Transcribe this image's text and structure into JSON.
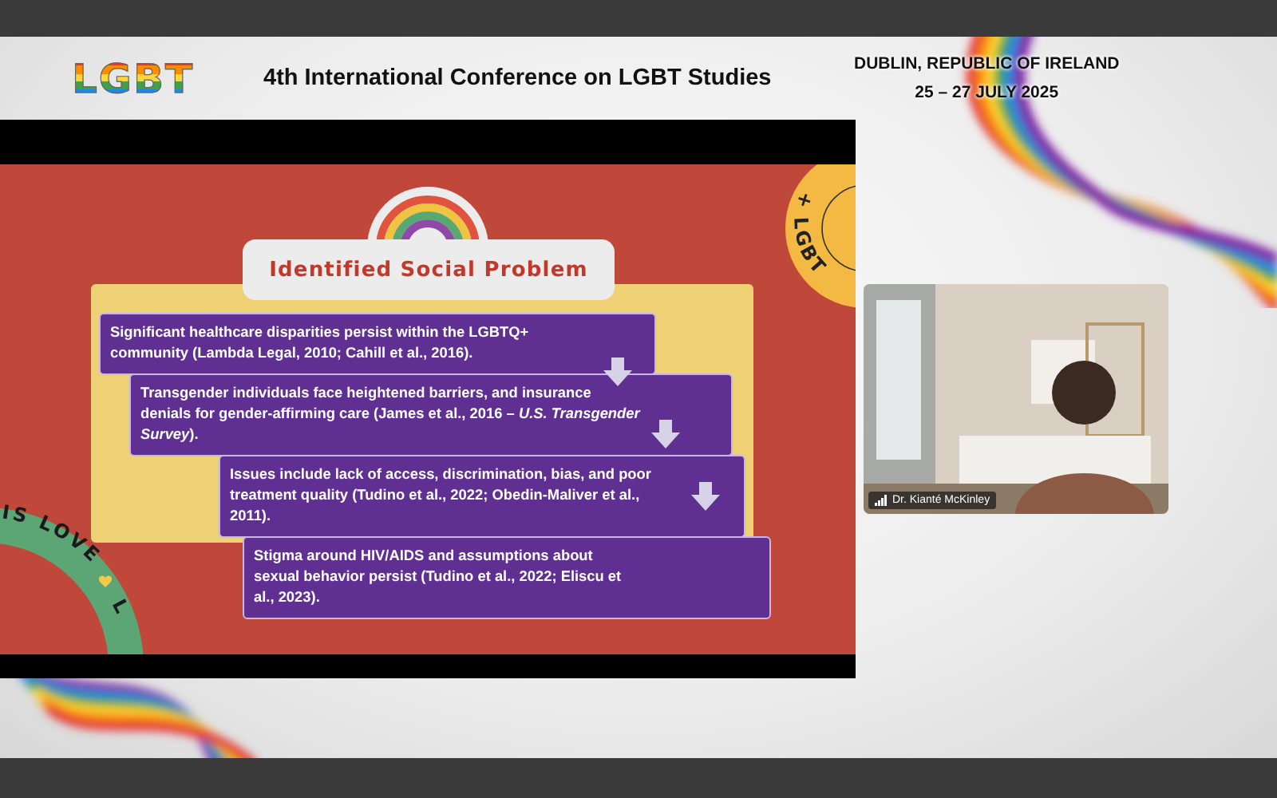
{
  "header": {
    "logo": "LGBT",
    "title": "4th International Conference on LGBT Studies",
    "location": "DUBLIN, REPUBLIC OF IRELAND",
    "dates": "25 – 27 JULY 2025"
  },
  "slide": {
    "title": "Identified Social Problem",
    "points": [
      "Significant healthcare disparities persist within the LGBTQ+ community (Lambda Legal, 2010; Cahill et al., 2016).",
      "Transgender individuals face heightened barriers, and insurance denials for gender-affirming care (James et al., 2016 – *U.S. Transgender Survey*).",
      "Issues include lack of access, discrimination, bias, and poor treatment quality (Tudino et al., 2022; Obedin-Maliver et al., 2011).",
      "Stigma around HIV/AIDS and assumptions about sexual behavior persist (Tudino et al., 2022; Eliscu et al., 2023)."
    ],
    "badges": [
      {
        "kind": "top",
        "text": "+ LGBT"
      },
      {
        "kind": "bottom",
        "text": "IS LOVE",
        "tail": "L"
      }
    ]
  },
  "video": {
    "speaker": "Dr. Kianté McKinley"
  }
}
